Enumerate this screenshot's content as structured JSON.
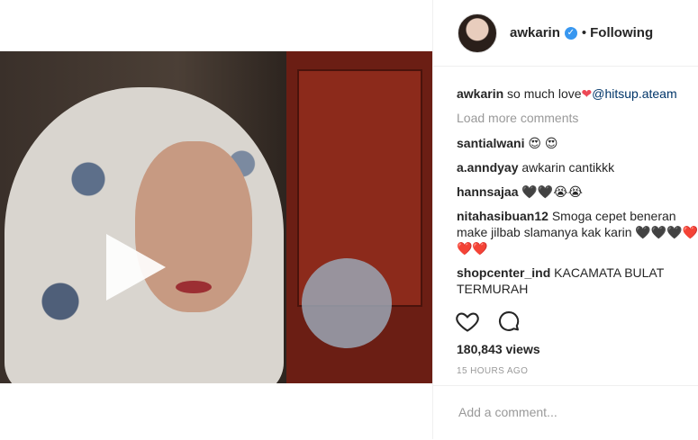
{
  "post": {
    "username": "awkarin",
    "follow_label": "Following",
    "caption_user": "awkarin",
    "caption_text": "so much love",
    "caption_mention": "@hitsup.ateam",
    "load_more": "Load more comments",
    "comments": [
      {
        "user": "santialwani",
        "text": "😍 😍"
      },
      {
        "user": "a.anndyay",
        "text": "awkarin cantikkk"
      },
      {
        "user": "hannsajaa",
        "text": "🖤🖤😭😭"
      },
      {
        "user": "nitahasibuan12",
        "text": "Smoga cepet beneran make jilbab slamanya kak karin 🖤🖤🖤❤️❤️❤️"
      },
      {
        "user": "shopcenter_ind",
        "text": "KACAMATA BULAT TERMURAH"
      }
    ],
    "views": "180,843 views",
    "time": "15 HOURS AGO",
    "comment_placeholder": "Add a comment..."
  },
  "icons": {
    "like": "heart-outline-icon",
    "comment": "speech-bubble-icon",
    "verified": "verified-badge-icon",
    "play": "play-icon"
  },
  "colors": {
    "link": "#003569",
    "verified": "#3897f0",
    "muted": "#999999"
  }
}
